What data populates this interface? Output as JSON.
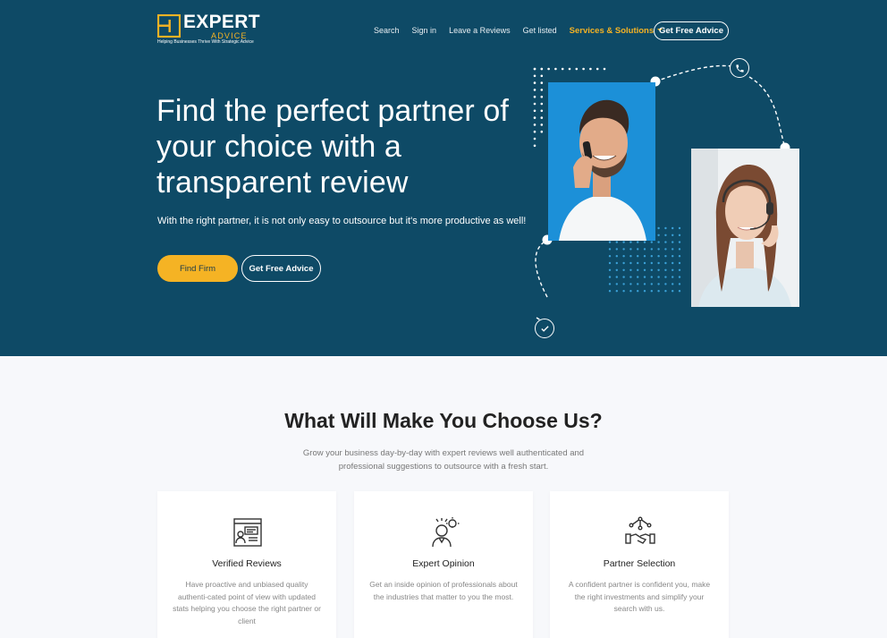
{
  "brand": {
    "name": "EXPERT",
    "sub": "ADVICE",
    "tagline": "Helping Businesses Thrive With Strategic Advice",
    "accent": "#f5b324",
    "hero_bg": "#0e4a66"
  },
  "nav": {
    "items": [
      "Search",
      "Sign in",
      "Leave a Reviews",
      "Get listed"
    ],
    "services": "Services & Solutions",
    "cta": "Get Free Advice"
  },
  "hero": {
    "title": "Find the perfect partner of your choice with a transparent review",
    "subtitle": "With the right partner, it is not only easy to outsource but it's more productive as well!",
    "btn_find": "Find Firm",
    "btn_advice": "Get Free Advice"
  },
  "section": {
    "title": "What Will Make You Choose Us?",
    "subtitle": "Grow your business day-by-day with expert reviews well authenticated and professional suggestions to outsource with a fresh start."
  },
  "cards": [
    {
      "icon": "reviews-icon",
      "title": "Verified Reviews",
      "text": "Have proactive and unbiased quality authenti-cated point of view with updated stats helping you choose the right partner or client"
    },
    {
      "icon": "expert-icon",
      "title": "Expert Opinion",
      "text": "Get an inside opinion of professionals about the industries that matter to you the most."
    },
    {
      "icon": "handshake-icon",
      "title": "Partner Selection",
      "text": "A confident partner is confident you, make the right investments and simplify your search with us."
    }
  ]
}
